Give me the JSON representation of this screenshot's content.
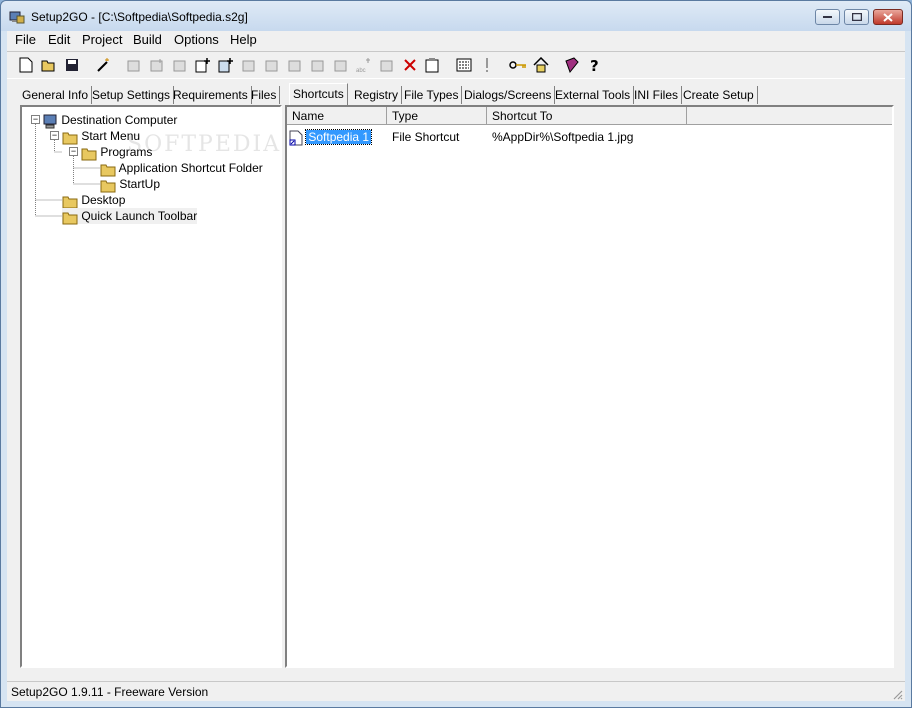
{
  "title": "Setup2GO - [C:\\Softpedia\\Softpedia.s2g]",
  "menu": [
    "File",
    "Edit",
    "Project",
    "Build",
    "Options",
    "Help"
  ],
  "tabs": [
    "General Info",
    "Setup Settings",
    "Requirements",
    "Files",
    "Shortcuts",
    "Registry",
    "File Types",
    "Dialogs/Screens",
    "External Tools",
    "INI Files",
    "Create Setup"
  ],
  "active_tab": "Shortcuts",
  "tree": {
    "root": "Destination Computer",
    "start_menu": "Start Menu",
    "programs": "Programs",
    "app_shortcut_folder": "Application Shortcut Folder",
    "startup": "StartUp",
    "desktop": "Desktop",
    "quick_launch": "Quick Launch Toolbar"
  },
  "watermark": "SOFTPEDIA",
  "list": {
    "columns": [
      "Name",
      "Type",
      "Shortcut To"
    ],
    "rows": [
      {
        "name": "Softpedia 1",
        "type": "File Shortcut",
        "target": "%AppDir%\\Softpedia 1.jpg"
      }
    ]
  },
  "status": "Setup2GO 1.9.11 - Freeware Version",
  "colors": {
    "selection": "#3399ff",
    "folder": "#e8c860"
  }
}
